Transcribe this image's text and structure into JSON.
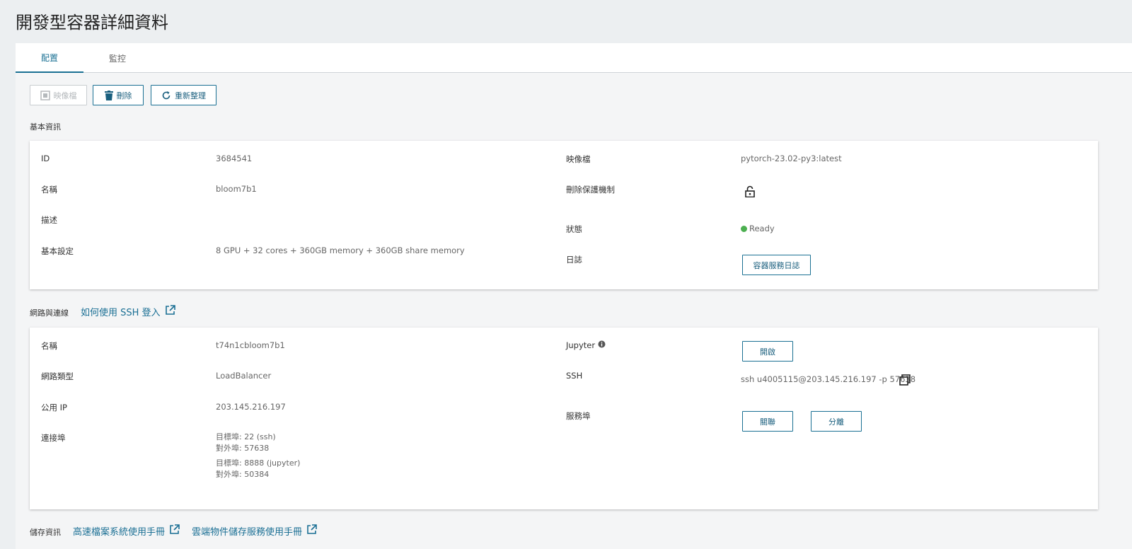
{
  "page": {
    "title": "開發型容器詳細資料"
  },
  "tabs": {
    "config": "配置",
    "monitor": "監控"
  },
  "toolbar": {
    "image_label": "映像檔",
    "delete_label": "刪除",
    "refresh_label": "重新整理"
  },
  "basic": {
    "section_title": "基本資訊",
    "id_label": "ID",
    "id_value": "3684541",
    "name_label": "名稱",
    "name_value": "bloom7b1",
    "desc_label": "描述",
    "desc_value": "",
    "spec_label": "基本設定",
    "spec_value": "8 GPU + 32 cores + 360GB memory + 360GB share memory",
    "image_label": "映像檔",
    "image_value": "pytorch-23.02-py3:latest",
    "protect_label": "刪除保護機制",
    "protect_icon": "unlock-icon",
    "status_label": "狀態",
    "status_value": "Ready",
    "status_color": "#4caf50",
    "log_label": "日誌",
    "log_button": "容器服務日誌"
  },
  "network": {
    "section_title": "網路與連線",
    "ssh_help_link": "如何使用 SSH 登入",
    "name_label": "名稱",
    "name_value": "t74n1cbloom7b1",
    "type_label": "網路類型",
    "type_value": "LoadBalancer",
    "ip_label": "公用 IP",
    "ip_value": "203.145.216.197",
    "ports_label": "連接埠",
    "ports": [
      {
        "target": "目標埠: 22 (ssh)",
        "external": "對外埠: 57638"
      },
      {
        "target": "目標埠: 8888 (jupyter)",
        "external": "對外埠: 50384"
      }
    ],
    "jupyter_label": "Jupyter",
    "jupyter_button": "開啟",
    "ssh_label": "SSH",
    "ssh_value": "ssh u4005115@203.145.216.197 -p 57638",
    "service_port_label": "服務埠",
    "associate_button": "關聯",
    "detach_button": "分離"
  },
  "storage": {
    "section_title": "儲存資訊",
    "hfs_link": "高速檔案系統使用手冊",
    "cos_link": "雲端物件儲存服務使用手冊"
  },
  "colors": {
    "accent": "#1a7093",
    "background": "#eceff1"
  }
}
